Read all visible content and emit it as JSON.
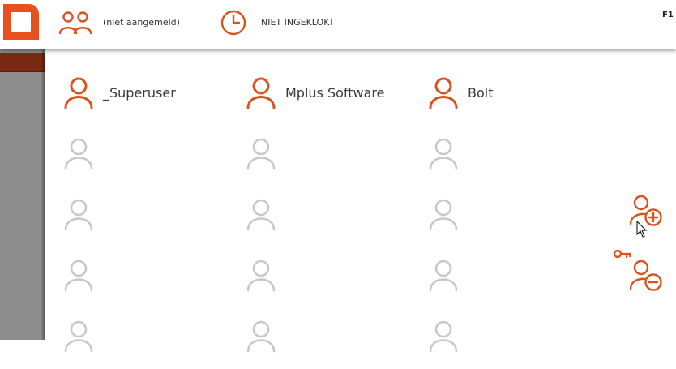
{
  "header": {
    "login_status": "(niet aangemeld)",
    "clock_status": "NIET INGEKLOKT",
    "help_key": "F1"
  },
  "icons": {
    "logo": "app-logo-icon",
    "users": "users-icon",
    "clock": "clock-icon",
    "user": "user-icon",
    "add_user": "add-user-icon",
    "remove_user": "remove-user-icon",
    "key": "key-icon",
    "cursor": "mouse-pointer-icon"
  },
  "users": [
    {
      "name": "_Superuser",
      "active": true
    },
    {
      "name": "Mplus Software",
      "active": true
    },
    {
      "name": "Bolt",
      "active": true
    },
    {
      "name": "",
      "active": false
    },
    {
      "name": "",
      "active": false
    },
    {
      "name": "",
      "active": false
    },
    {
      "name": "",
      "active": false
    },
    {
      "name": "",
      "active": false
    },
    {
      "name": "",
      "active": false
    },
    {
      "name": "",
      "active": false
    },
    {
      "name": "",
      "active": false
    },
    {
      "name": "",
      "active": false
    },
    {
      "name": "",
      "active": false
    },
    {
      "name": "",
      "active": false
    },
    {
      "name": "",
      "active": false
    }
  ],
  "colors": {
    "accent": "#d9531e",
    "inactive": "#c8c8c8",
    "text": "#3a3a3a",
    "sidebar": "#8e8e8e",
    "sidebar_strip": "#7a2a12"
  }
}
